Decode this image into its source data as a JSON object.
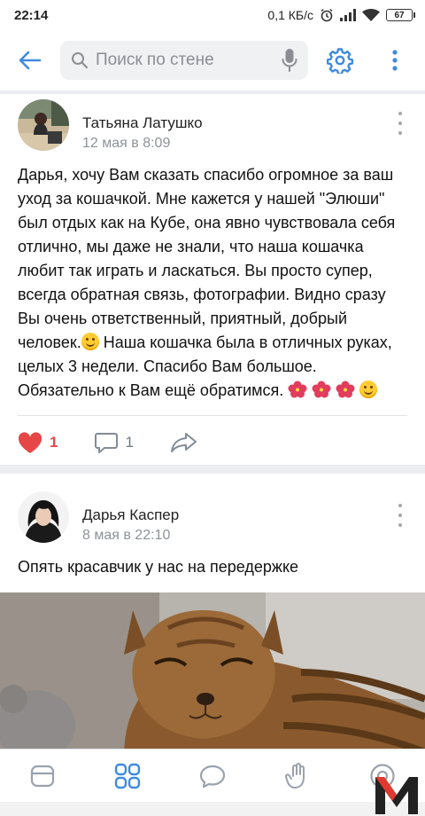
{
  "status_bar": {
    "time": "22:14",
    "network_speed": "0,1 КБ/с",
    "battery": "67"
  },
  "toolbar": {
    "search_placeholder": "Поиск по стене",
    "icons": [
      "back-arrow-icon",
      "search-icon",
      "microphone-icon",
      "settings-gear-icon",
      "more-vertical-icon"
    ],
    "accent": "#3f8ae0"
  },
  "posts": [
    {
      "author": "Татьяна Латушко",
      "date": "12 мая в 8:09",
      "text_part1": "Дарья, хочу Вам сказать  спасибо огромное за ваш уход за  кошачкой. Мне кажется у нашей \"Элюши\" был отдых как на Кубе, она явно чувствовала себя отлично, мы даже не знали, что наша кошачка любит так играть и ласкаться. Вы просто супер, всегда обратная связь, фотографии. Видно сразу Вы очень ответственный, приятный, добрый человек.",
      "text_part2": " Наша кошачка была в отличных руках, целых 3 недели. Спасибо Вам большое. Обязательно к Вам ещё обратимся. ",
      "likes": "1",
      "comments": "1"
    },
    {
      "author": "Дарья Каспер",
      "date": "8 мая в 22:10",
      "text": "Опять красавчик у нас на передержке"
    }
  ],
  "bottom_nav": {
    "icons": [
      "news-icon",
      "services-grid-icon",
      "messages-icon",
      "friends-hand-icon",
      "profile-icon"
    ]
  },
  "colors": {
    "like": "#e64646",
    "icon_gray": "#818c99",
    "accent": "#3f8ae0"
  }
}
